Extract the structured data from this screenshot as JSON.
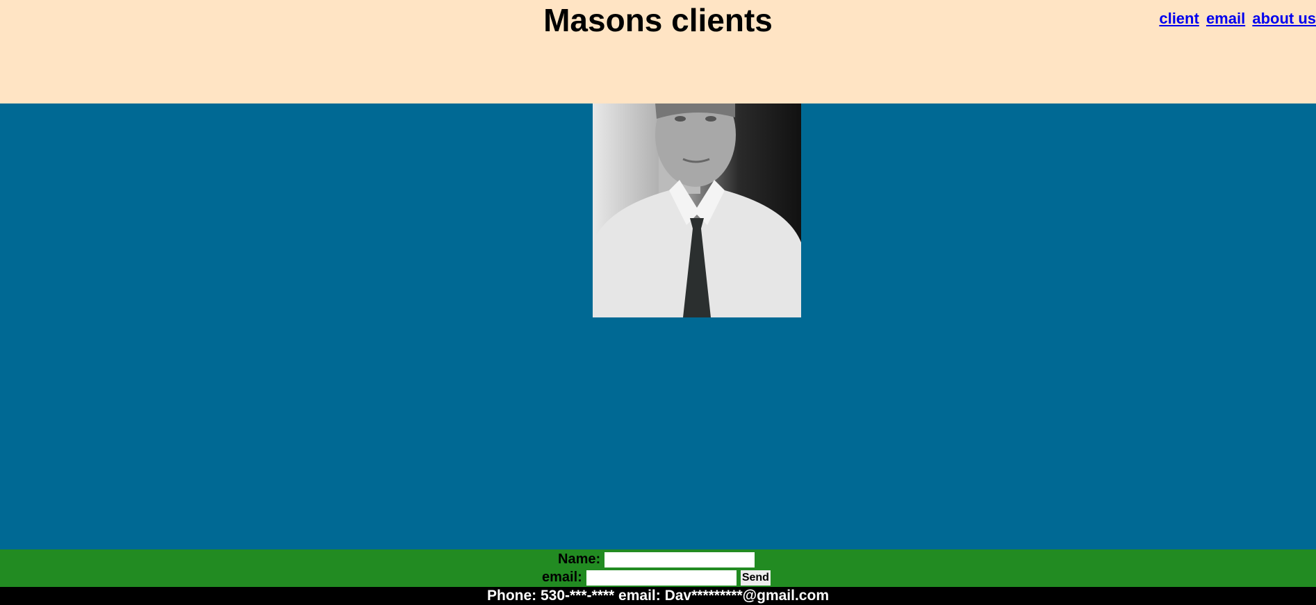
{
  "header": {
    "title": "Masons clients",
    "nav": [
      {
        "label": "client"
      },
      {
        "label": "email"
      },
      {
        "label": "about us"
      }
    ]
  },
  "form": {
    "name_label": "Name:",
    "name_value": "",
    "email_label": "email:",
    "email_value": "",
    "send_label": "Send"
  },
  "footer": {
    "text": "Phone: 530-***-**** email: Dav*********@gmail.com"
  },
  "colors": {
    "header": "#ffe4c4",
    "main": "#006994",
    "form": "#228b22",
    "footer": "#000000"
  }
}
